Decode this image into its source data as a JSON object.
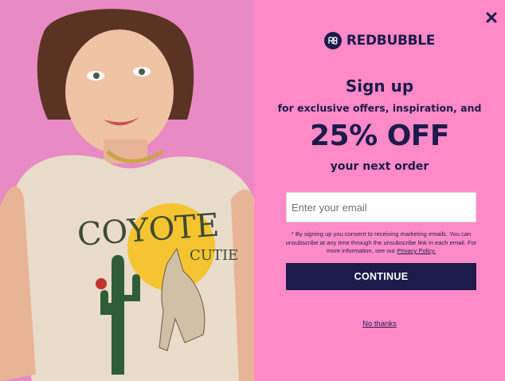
{
  "brand": {
    "name": "REDBUBBLE",
    "logo_icon": "redbubble-logo-icon"
  },
  "modal": {
    "heading": "Sign up",
    "subheading": "for exclusive offers, inspiration, and",
    "discount": "25% OFF",
    "discount_suffix": "your next order",
    "email": {
      "placeholder": "Enter your email",
      "value": ""
    },
    "consent": {
      "text": "* By signing up you consent to receiving marketing emails. You can unsubscribe at any time through the unsubscribe link in each email. For more information, see our",
      "link": "Privacy Policy."
    },
    "continue_label": "CONTINUE",
    "no_thanks_label": "No thanks",
    "close_icon": "close-icon"
  },
  "colors": {
    "panel_bg": "#ff8ac7",
    "navy": "#1c1b4b",
    "photo_bg": "#e58cc3"
  }
}
